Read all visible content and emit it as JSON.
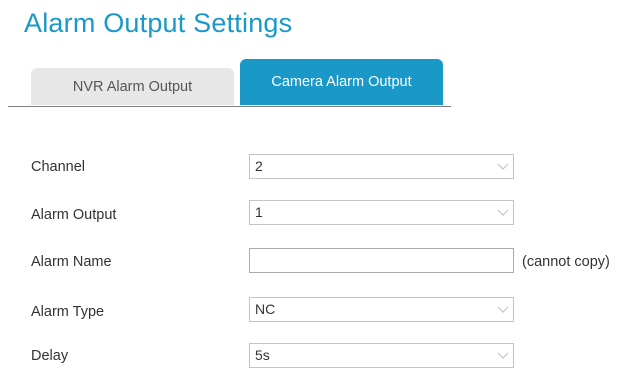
{
  "page_title": "Alarm Output Settings",
  "tabs": [
    {
      "label": "NVR Alarm Output",
      "active": false
    },
    {
      "label": "Camera Alarm Output",
      "active": true
    }
  ],
  "form": {
    "channel": {
      "label": "Channel",
      "value": "2"
    },
    "alarm_output": {
      "label": "Alarm Output",
      "value": "1"
    },
    "alarm_name": {
      "label": "Alarm Name",
      "value": "",
      "note": "(cannot copy)"
    },
    "alarm_type": {
      "label": "Alarm Type",
      "value": "NC"
    },
    "delay": {
      "label": "Delay",
      "value": "5s"
    }
  },
  "icons": {
    "dropdown": "chevron-down-icon"
  },
  "colors": {
    "accent": "#1a98c8",
    "inactive_tab": "#e7e7e7",
    "text": "#333333",
    "border": "#c4c4c4"
  }
}
